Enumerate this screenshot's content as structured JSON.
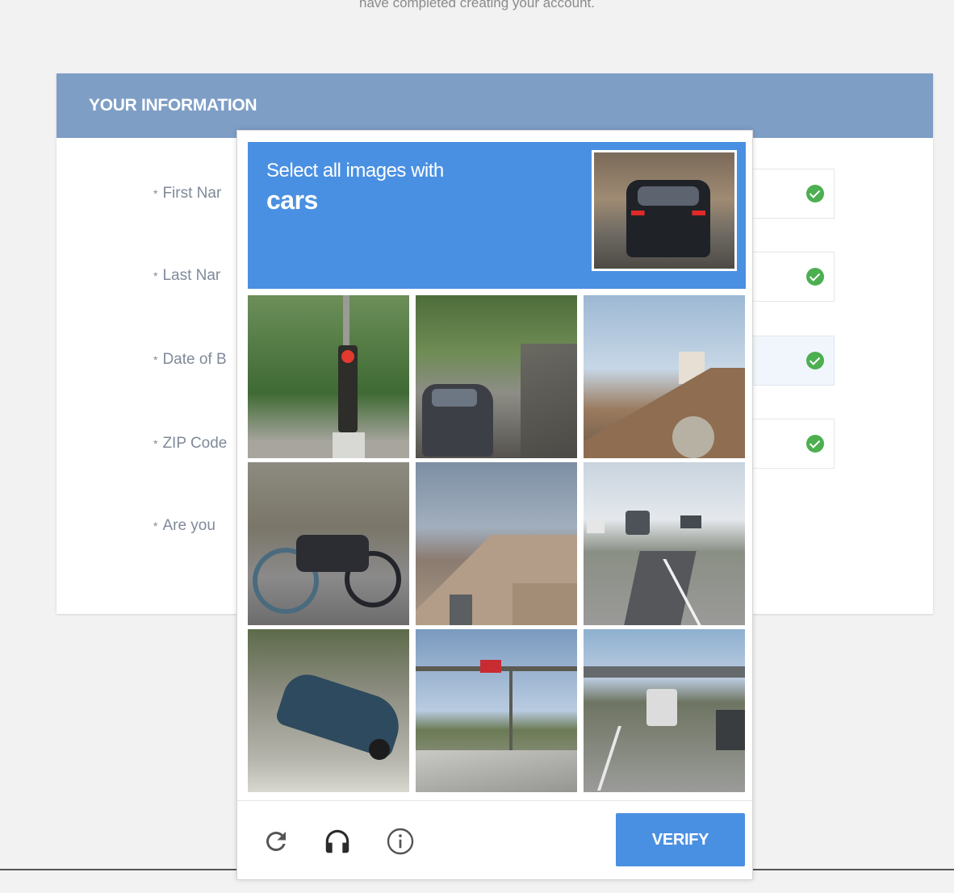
{
  "page": {
    "top_note": "have completed creating your account.",
    "section_title": "YOUR INFORMATION",
    "fields": [
      {
        "label": "First Nar"
      },
      {
        "label": "Last Nar"
      },
      {
        "label": "Date of B"
      },
      {
        "label": "ZIP Code"
      },
      {
        "label": "Are you"
      }
    ],
    "required_marker": "*"
  },
  "captcha": {
    "prompt": "Select all images with",
    "object": "cars",
    "tiles": [
      "traffic-light",
      "tree-lined-street-with-car",
      "house-roof",
      "parked-motorcycles",
      "brick-house",
      "highway-traffic",
      "parked-car",
      "traffic-signal-intersection",
      "highway-overpass-traffic"
    ],
    "icons": [
      "reload-icon",
      "audio-icon",
      "info-icon"
    ],
    "verify_label": "VERIFY",
    "accent_color": "#4a90e2"
  }
}
